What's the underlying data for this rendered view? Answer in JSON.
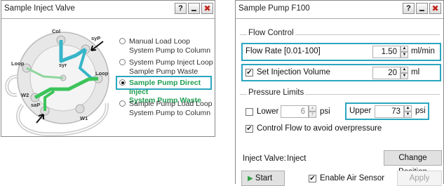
{
  "valve_window": {
    "title": "Sample Inject Valve",
    "help_label": "?",
    "ports": {
      "col": "Col",
      "syp": "syP",
      "syr": "syr",
      "loop_left": "Loop",
      "loop_right": "Loop",
      "w2": "W2",
      "sap": "saP",
      "w1": "W1"
    },
    "options": [
      {
        "line1": "Manual Load Loop",
        "line2": "System Pump to Column",
        "selected": false
      },
      {
        "line1": "System Pump Inject Loop",
        "line2": "Sample Pump Waste",
        "selected": false
      },
      {
        "line1": "Sample Pump Direct Inject",
        "line2": "System Pump Waste",
        "selected": true
      },
      {
        "line1": "Sample Pump Load Loop",
        "line2": "System Pump to Column",
        "selected": false
      }
    ],
    "colors": {
      "highlight": "#2ba6c1",
      "selected_text": "#1f9e52",
      "flow_green": "#3cc45a"
    }
  },
  "pump_window": {
    "title": "Sample Pump F100",
    "help_label": "?",
    "flow_control": {
      "group_label": "Flow Control",
      "flow_rate_label": "Flow Rate [0.01-100]",
      "flow_rate_value": "1.50",
      "flow_rate_unit": "ml/min",
      "injection_label": "Set Injection Volume",
      "injection_checked": true,
      "injection_value": "20",
      "injection_unit": "ml"
    },
    "pressure_limits": {
      "group_label": "Pressure Limits",
      "lower_label": "Lower",
      "lower_checked": false,
      "lower_value": "6",
      "lower_unit": "psi",
      "upper_label": "Upper",
      "upper_value": "73",
      "upper_unit": "psi",
      "control_flow_label": "Control Flow to avoid overpressure",
      "control_flow_checked": true
    },
    "inject_valve_label": "Inject Valve:",
    "inject_valve_value": "Inject",
    "change_position_label": "Change Position",
    "start_label": "Start",
    "enable_air_sensor_label": "Enable Air Sensor",
    "enable_air_sensor_checked": true,
    "apply_label": "Apply"
  }
}
